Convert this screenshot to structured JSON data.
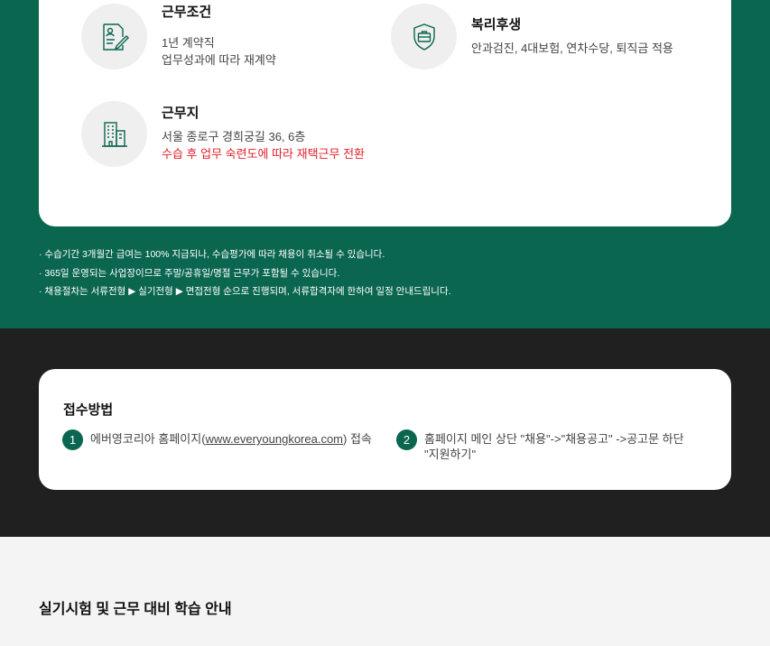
{
  "benefits": {
    "work_conditions": {
      "icon": "contract-pen-icon",
      "title": "근무조건",
      "lines": [
        "1년 계약직",
        "업무성과에 따라 재계약"
      ]
    },
    "welfare": {
      "icon": "shield-briefcase-icon",
      "title": "복리후생",
      "lines": [
        "안과검진, 4대보험, 연차수당, 퇴직금 적용"
      ]
    },
    "workplace": {
      "icon": "building-icon",
      "title": "근무지",
      "lines": [
        "서울 종로구 경희궁길 36, 6층"
      ],
      "highlight": "수습 후 업무 숙련도에 따라 재택근무 전환"
    }
  },
  "notes": [
    "· 수습기간 3개월간 급여는 100% 지급되나, 수습평가에 따라 채용이 취소될 수 있습니다.",
    "· 365일 운영되는 사업장이므로 주말/공휴일/명절 근무가 포함될 수 있습니다.",
    "· 채용절차는 서류전형 ▶ 실기전형 ▶ 면접전형 순으로 진행되며, 서류합격자에 한하여 일정 안내드립니다."
  ],
  "apply": {
    "title": "접수방법",
    "steps": [
      {
        "num": "1",
        "prefix": "에버영코리아 홈페이지(",
        "link": "www.everyoungkorea.com",
        "suffix": ") 접속"
      },
      {
        "num": "2",
        "line1": "홈페이지 메인 상단 \"채용\"->\"채용공고\" ->공고문 하단",
        "line2": "\"지원하기\""
      }
    ]
  },
  "next_section": {
    "title": "실기시험 및 근무 대비 학습 안내"
  },
  "colors": {
    "brand_green": "#0b6650",
    "dark_band": "#202020",
    "highlight_red": "#e0202a",
    "icon_bg": "#efefef"
  }
}
